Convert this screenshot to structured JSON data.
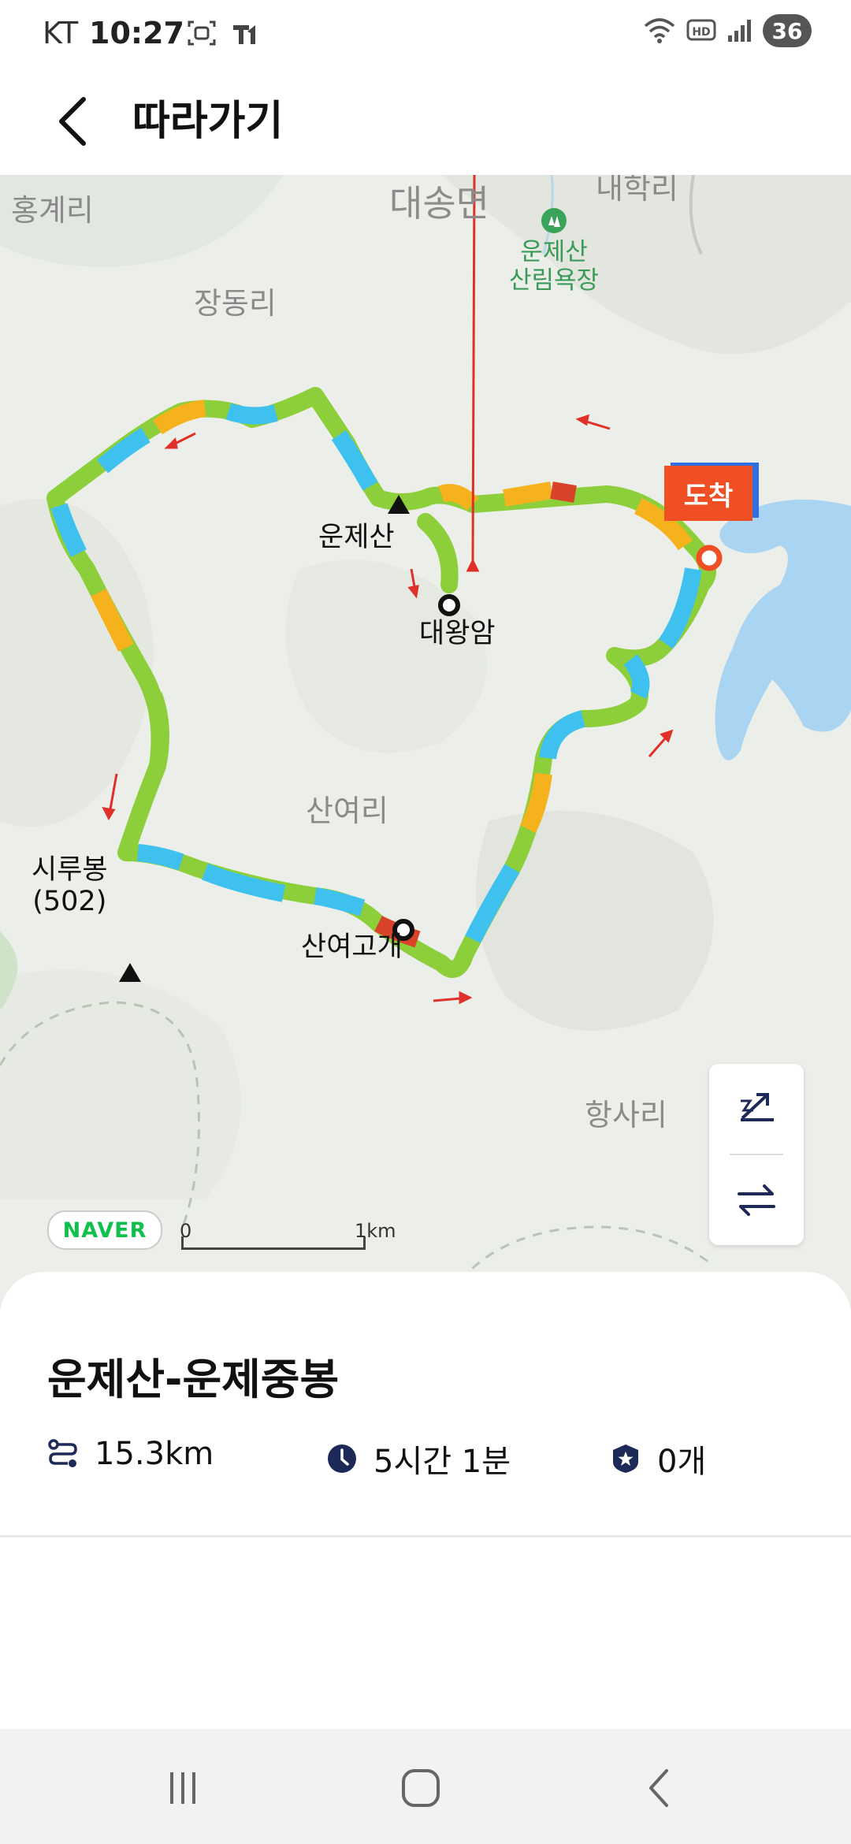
{
  "status": {
    "carrier": "KT",
    "time": "10:27",
    "battery": "36"
  },
  "header": {
    "title": "따라가기"
  },
  "map": {
    "labels": {
      "hongye": "홍계리",
      "daesong": "대송면",
      "naehang": "내학리",
      "forest_line1": "운제산",
      "forest_line2": "산림욕장",
      "jangdong": "장동리",
      "sanyeo": "산여리",
      "hangsa": "항사리"
    },
    "pois": {
      "unjesan": "운제산",
      "daewangam": "대왕암",
      "sirubong_line1": "시루봉",
      "sirubong_line2": "(502)",
      "sanyeogogae": "산여고개"
    },
    "arrive_badge": "도착",
    "brand": "NAVER",
    "scale_start": "0",
    "scale_end": "1km",
    "colors": {
      "arrive": "#f04e23",
      "water": "#a9d4f2",
      "route_green": "#8ccf3a",
      "route_cyan": "#3fc1f0",
      "route_orange": "#f6b21c",
      "route_red": "#d9432a"
    }
  },
  "course": {
    "name": "운제산-운제중봉",
    "distance": "15.3km",
    "duration": "5시간 1분",
    "stamps": "0개"
  },
  "icons": {
    "distance": "route-icon",
    "duration": "clock-icon",
    "stamps": "badge-icon",
    "elevation": "elevation-toggle-icon",
    "reverse": "reverse-direction-icon"
  }
}
